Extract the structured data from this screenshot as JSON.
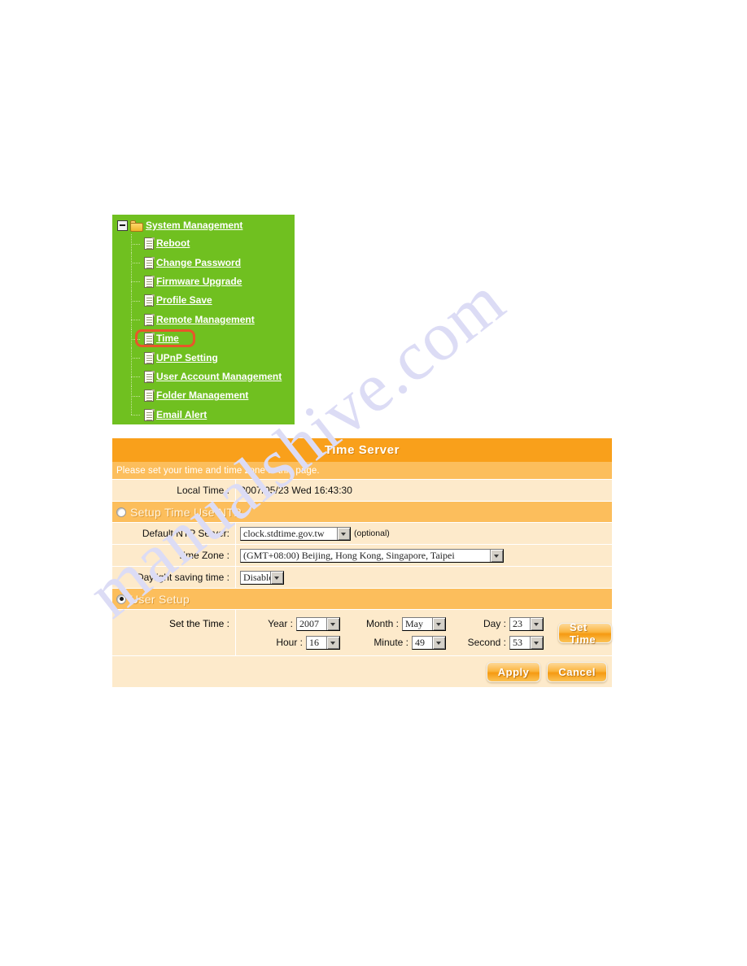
{
  "tree": {
    "root": {
      "label": "System Management",
      "icon": "folder-icon",
      "expander": "minus-box-icon"
    },
    "items": [
      {
        "label": "Reboot",
        "icon": "page-icon"
      },
      {
        "label": "Change Password",
        "icon": "page-icon"
      },
      {
        "label": "Firmware Upgrade",
        "icon": "page-icon"
      },
      {
        "label": "Profile Save",
        "icon": "page-icon"
      },
      {
        "label": "Remote Management",
        "icon": "page-icon"
      },
      {
        "label": "Time",
        "icon": "page-icon",
        "highlighted": true
      },
      {
        "label": "UPnP Setting",
        "icon": "page-icon"
      },
      {
        "label": "User Account Management",
        "icon": "page-icon"
      },
      {
        "label": "Folder Management",
        "icon": "page-icon"
      },
      {
        "label": "Email Alert",
        "icon": "page-icon"
      }
    ]
  },
  "panel": {
    "title": "Time Server",
    "description": "Please set your time and time zone in this page.",
    "local_time": {
      "label": "Local Time :",
      "value": "2007/05/23 Wed 16:43:30"
    },
    "ntp_section": {
      "label": "Setup Time Use NTP",
      "selected": false,
      "ntp_server": {
        "label": "Default NTP Server:",
        "value": "clock.stdtime.gov.tw",
        "hint": "(optional)"
      },
      "time_zone": {
        "label": "Time Zone :",
        "value": "(GMT+08:00) Beijing, Hong Kong, Singapore, Taipei"
      },
      "daylight": {
        "label": "Daylight saving time :",
        "value": "Disable"
      }
    },
    "user_section": {
      "label": "User Setup",
      "selected": true,
      "set_time_label": "Set the Time :",
      "fields": [
        {
          "label": "Year :",
          "value": "2007"
        },
        {
          "label": "Month :",
          "value": "May"
        },
        {
          "label": "Day :",
          "value": "23"
        },
        {
          "label": "Hour :",
          "value": "16"
        },
        {
          "label": "Minute :",
          "value": "49"
        },
        {
          "label": "Second :",
          "value": "53"
        }
      ],
      "set_time_button": "Set Time"
    },
    "actions": {
      "apply": "Apply",
      "cancel": "Cancel"
    }
  },
  "watermark": {
    "text": "manualshive.com"
  },
  "colors": {
    "tree_background": "#70c020",
    "panel_title_bg": "#f9a01b",
    "panel_section_bg": "#fcbe5c",
    "panel_body_bg": "#fdeacb",
    "highlight_border": "#e8562a",
    "button_accent": "#f59a12"
  }
}
